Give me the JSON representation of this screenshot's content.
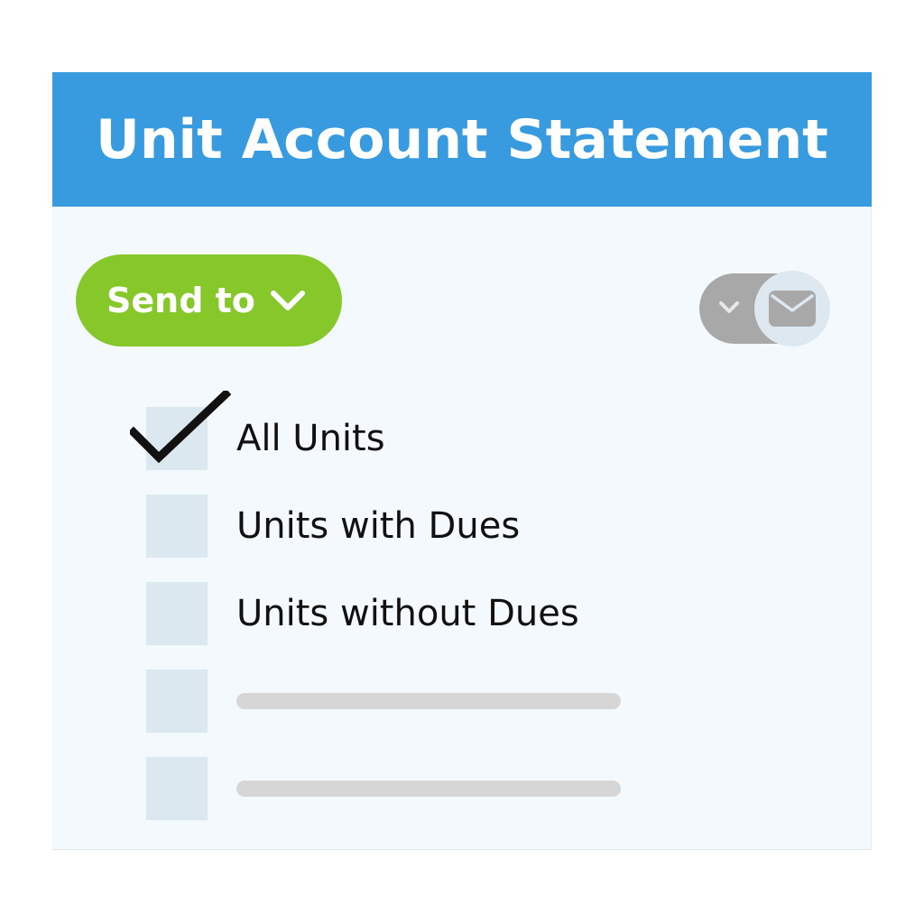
{
  "header": {
    "title": "Unit Account Statement"
  },
  "send_button": {
    "label": "Send to"
  },
  "toggle": {
    "state": "on",
    "icon": "envelope-icon"
  },
  "options": [
    {
      "label": "All Units",
      "checked": true
    },
    {
      "label": "Units with Dues",
      "checked": false
    },
    {
      "label": "Units without Dues",
      "checked": false
    },
    {
      "label": "",
      "checked": false,
      "placeholder": true
    },
    {
      "label": "",
      "checked": false,
      "placeholder": true
    }
  ],
  "colors": {
    "header_bg": "#389be0",
    "card_bg": "#f4f9fd",
    "send_button_bg": "#86c82a",
    "toggle_track": "#a8a8a8",
    "toggle_knob": "#dde8f0",
    "checkbox_bg": "#dce8f0",
    "placeholder_bar": "#d6d6d6"
  }
}
